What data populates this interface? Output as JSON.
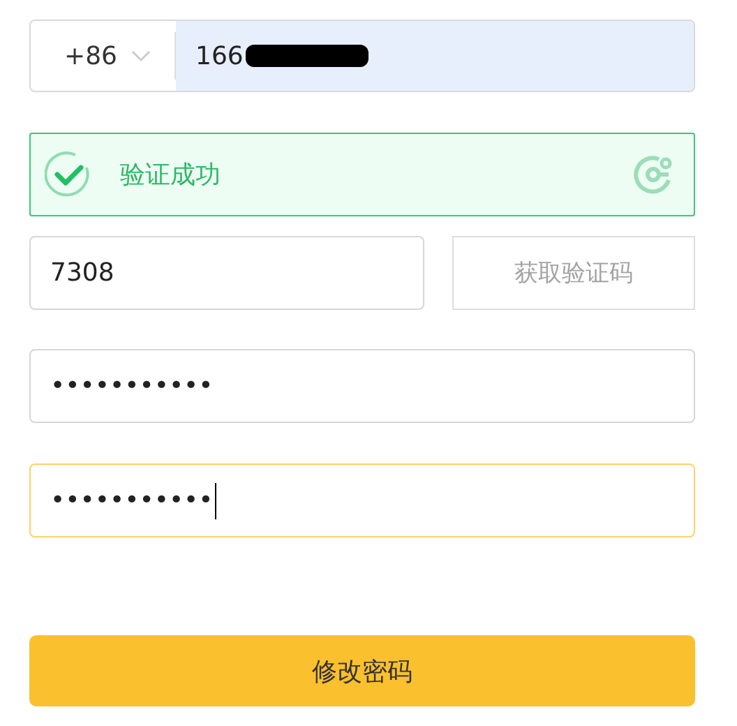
{
  "phone": {
    "country_code": "+86",
    "value": "166",
    "redacted": true
  },
  "captcha": {
    "text": "验证成功",
    "verified": true
  },
  "sms_code": {
    "value": "7308",
    "button": {
      "label": "获取验证码",
      "disabled": true
    }
  },
  "password": {
    "value": "•••••••••••",
    "focused": false
  },
  "confirm_password": {
    "value": "•••••••••••",
    "focused": true
  },
  "submit": {
    "label": "修改密码"
  }
}
